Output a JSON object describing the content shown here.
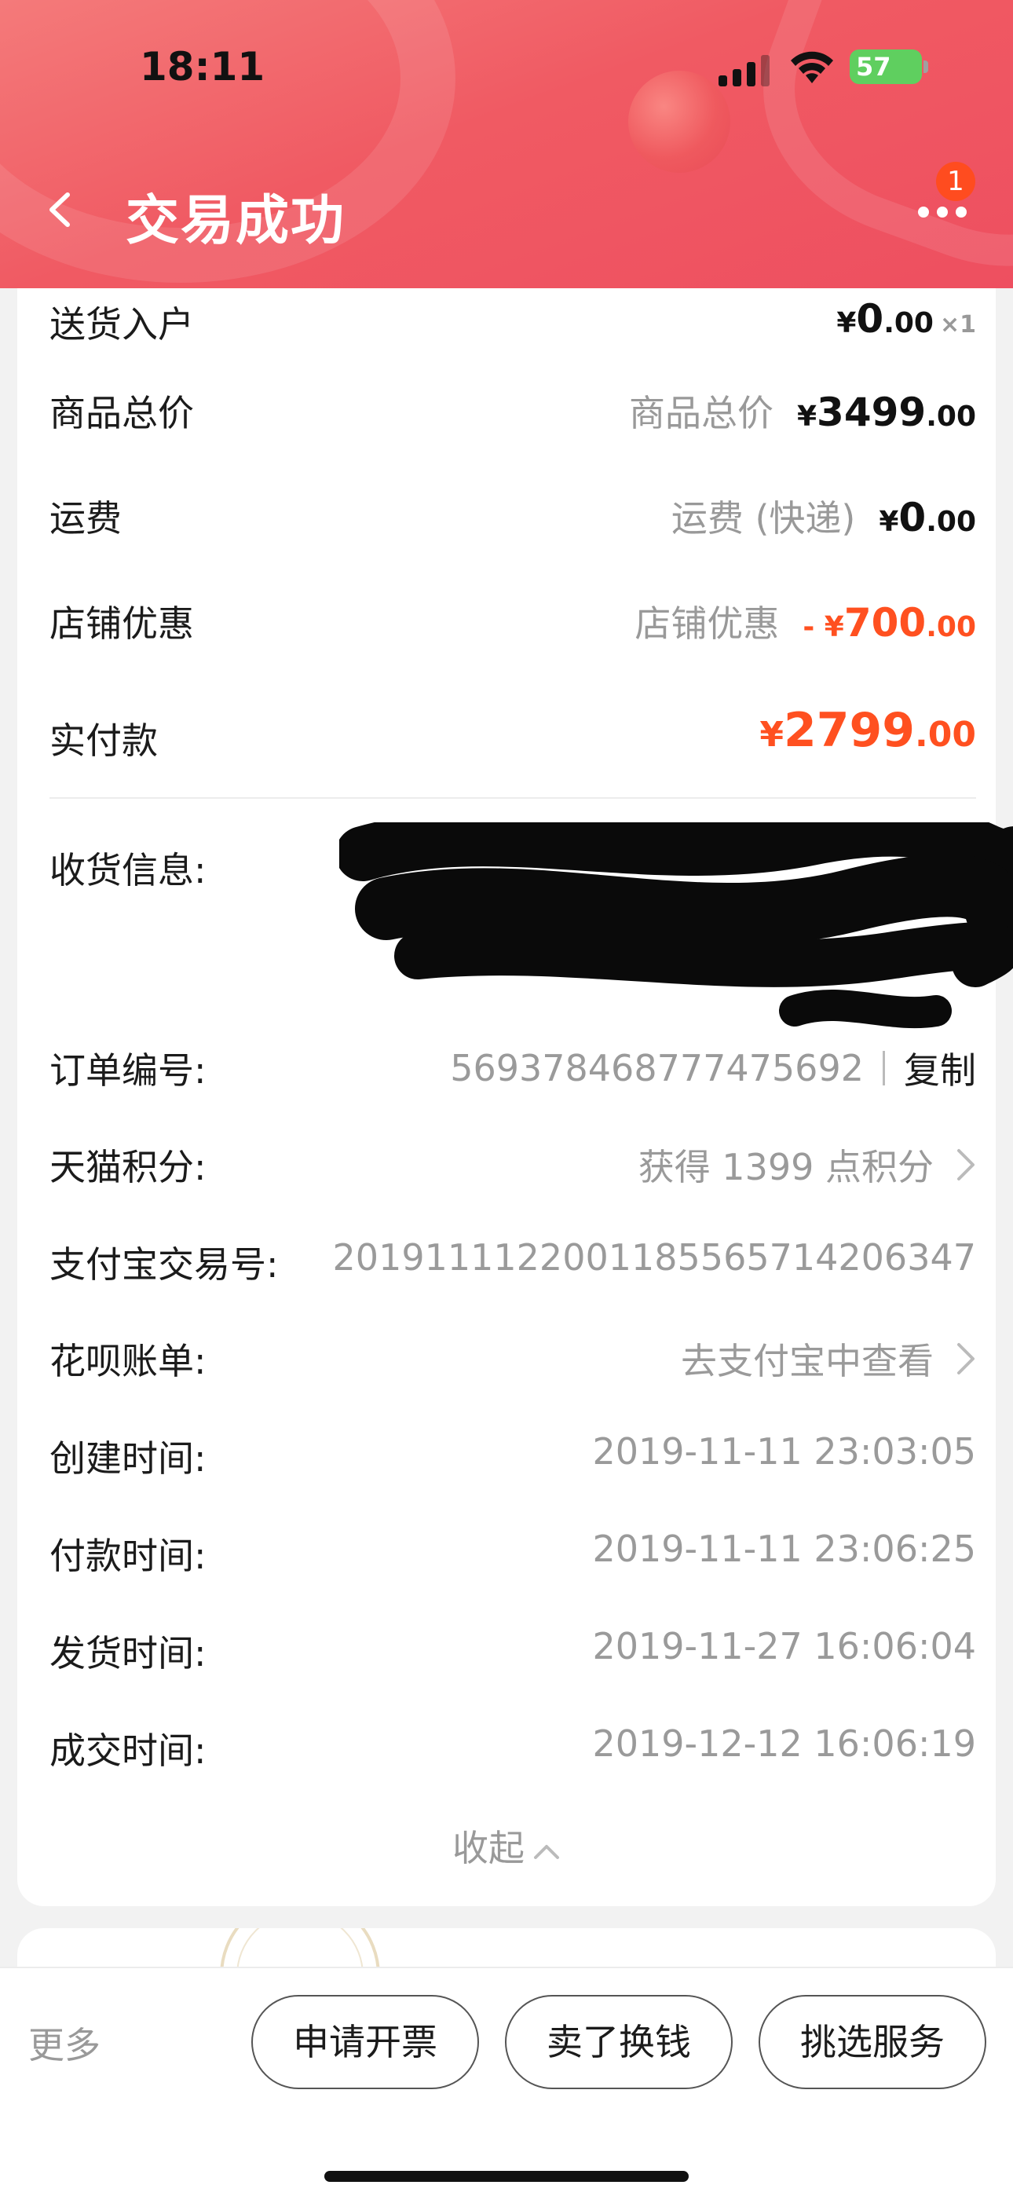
{
  "status": {
    "time": "18:11",
    "battery": "57"
  },
  "header": {
    "title": "交易成功",
    "notification_count": "1"
  },
  "summary": [
    {
      "label": "送货入户",
      "right_label": "",
      "price_int": "0",
      "price_dec": ".00",
      "qty": "×1"
    },
    {
      "label": "商品总价",
      "right_label": "商品总价",
      "price_int": "3499",
      "price_dec": ".00"
    },
    {
      "label": "运费",
      "right_label": "运费 (快递)",
      "price_int": "0",
      "price_dec": ".00"
    },
    {
      "label": "店铺优惠",
      "right_label": "店铺优惠",
      "prefix": "- ¥",
      "price_int": "700",
      "price_dec": ".00"
    },
    {
      "label": "实付款",
      "price_int": "2799",
      "price_dec": ".00"
    }
  ],
  "currency": "¥",
  "shipping_info": {
    "label": "收货信息:"
  },
  "details": [
    {
      "label": "订单编号:",
      "value": "569378468777475692",
      "action": "复制"
    },
    {
      "label": "天猫积分:",
      "value": "获得 1399 点积分"
    },
    {
      "label": "支付宝交易号:",
      "value": "2019111122001185565714206347"
    },
    {
      "label": "花呗账单:",
      "value": "去支付宝中查看"
    },
    {
      "label": "创建时间:",
      "value": "2019-11-11 23:03:05"
    },
    {
      "label": "付款时间:",
      "value": "2019-11-11 23:06:25"
    },
    {
      "label": "发货时间:",
      "value": "2019-11-27 16:06:04"
    },
    {
      "label": "成交时间:",
      "value": "2019-12-12 16:06:19"
    }
  ],
  "collapse_label": "收起",
  "bottom_bar": {
    "more": "更多",
    "buttons": [
      "申请开票",
      "卖了换钱",
      "挑选服务"
    ]
  },
  "colors": {
    "header": "#f05a63",
    "accent": "#ff5020",
    "badge": "#ff4c1f"
  }
}
